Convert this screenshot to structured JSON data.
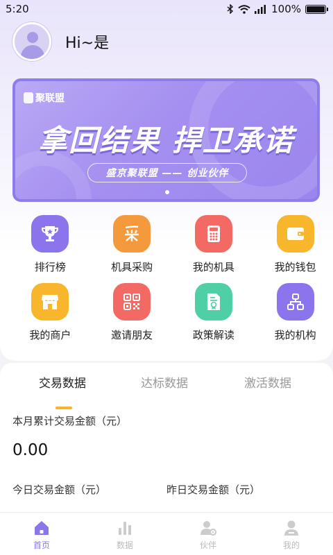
{
  "status_bar": {
    "time": "5:20",
    "battery_text": "100%",
    "battery_level": 1.0,
    "icons": [
      "bluetooth-icon",
      "wifi-icon",
      "signal-icon",
      "battery-icon"
    ]
  },
  "header": {
    "greeting": "Hi~是"
  },
  "banner": {
    "logo_text": "聚联盟",
    "title": "拿回结果 捍卫承诺",
    "subtitle": "盛京聚联盟 —— 创业伙伴",
    "page_count": 1,
    "active_page": 1
  },
  "grid": {
    "items": [
      {
        "label": "排行榜",
        "icon": "trophy-icon",
        "color": "#8b74ec"
      },
      {
        "label": "机具采购",
        "icon": "purchase-icon",
        "color": "#f49a3c"
      },
      {
        "label": "我的机具",
        "icon": "calculator-icon",
        "color": "#f26a63"
      },
      {
        "label": "我的钱包",
        "icon": "wallet-icon",
        "color": "#f7b62b"
      },
      {
        "label": "我的商户",
        "icon": "store-icon",
        "color": "#f7b62b"
      },
      {
        "label": "邀请朋友",
        "icon": "qrcode-icon",
        "color": "#f26a63"
      },
      {
        "label": "政策解读",
        "icon": "certificate-icon",
        "color": "#4fcfa6"
      },
      {
        "label": "我的机构",
        "icon": "org-chart-icon",
        "color": "#8b74ec"
      }
    ]
  },
  "data_card": {
    "tabs": [
      {
        "label": "交易数据",
        "active": true
      },
      {
        "label": "达标数据",
        "active": false
      },
      {
        "label": "激活数据",
        "active": false
      }
    ],
    "month_total_label": "本月累计交易金额（元）",
    "month_total_value": "0.00",
    "today_label": "今日交易金额（元）",
    "yesterday_label": "昨日交易金额（元）"
  },
  "bottom_nav": {
    "items": [
      {
        "label": "首页",
        "icon": "home-icon",
        "active": true
      },
      {
        "label": "数据",
        "icon": "bar-chart-icon",
        "active": false
      },
      {
        "label": "伙伴",
        "icon": "partner-icon",
        "active": false
      },
      {
        "label": "我的",
        "icon": "user-icon",
        "active": false
      }
    ]
  },
  "colors": {
    "accent": "#8a76e8",
    "tab_indicator": "#f7b52c",
    "banner": "#a58ff0"
  }
}
